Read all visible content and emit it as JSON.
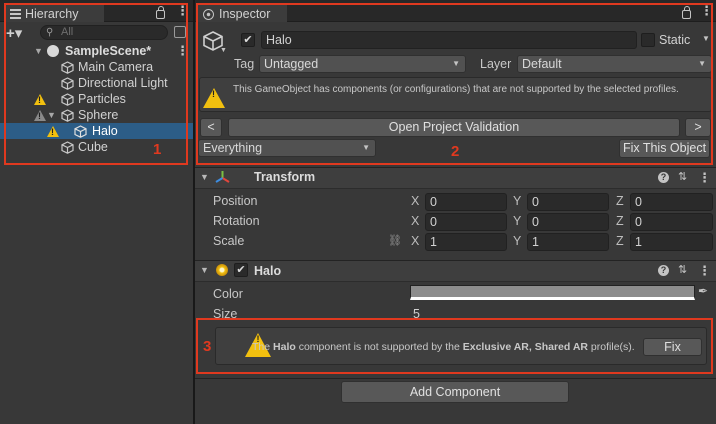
{
  "hierarchy": {
    "tab_label": "Hierarchy",
    "add_label": "+▾",
    "search_placeholder": "All",
    "items": [
      {
        "label": "SampleScene*",
        "depth": 0,
        "warning": "none"
      },
      {
        "label": "Main Camera",
        "depth": 1,
        "warning": "none"
      },
      {
        "label": "Directional Light",
        "depth": 1,
        "warning": "none"
      },
      {
        "label": "Particles",
        "depth": 1,
        "warning": "yellow"
      },
      {
        "label": "Sphere",
        "depth": 1,
        "warning": "grey"
      },
      {
        "label": "Halo",
        "depth": 2,
        "warning": "yellow",
        "selected": true
      },
      {
        "label": "Cube",
        "depth": 1,
        "warning": "none"
      }
    ]
  },
  "inspector": {
    "tab_label": "Inspector",
    "object_name": "Halo",
    "active_checked": "✔",
    "static_label": "Static",
    "tag_label": "Tag",
    "tag_value": "Untagged",
    "layer_label": "Layer",
    "layer_value": "Default",
    "unsupported_message": "This GameObject has components (or configurations) that are not supported by the selected profiles.",
    "nav_prev": "<",
    "open_validation_label": "Open Project Validation",
    "nav_next": ">",
    "filter_value": "Everything",
    "fix_object_label": "Fix This Object",
    "transform": {
      "title": "Transform",
      "rows": [
        {
          "label": "Position",
          "x": "0",
          "y": "0",
          "z": "0"
        },
        {
          "label": "Rotation",
          "x": "0",
          "y": "0",
          "z": "0"
        },
        {
          "label": "Scale",
          "x": "1",
          "y": "1",
          "z": "1"
        }
      ],
      "axis_x": "X",
      "axis_y": "Y",
      "axis_z": "Z"
    },
    "halo": {
      "title": "Halo",
      "enabled_check": "✔",
      "color_label": "Color",
      "size_label": "Size",
      "size_value": "5",
      "warning_prefix": "The ",
      "warning_component": "Halo",
      "warning_middle": " component is not supported by the ",
      "warning_profiles": "Exclusive AR, Shared AR",
      "warning_suffix": " profile(s).",
      "fix_label": "Fix"
    },
    "add_component_label": "Add Component"
  },
  "annotations": {
    "box1_label": "1",
    "box2_label": "2",
    "box3_label": "3",
    "color": "#e0391f"
  },
  "colors": {
    "selection": "#2c5d87",
    "warning_yellow": "#f2c00f",
    "panel_bg": "#383838"
  }
}
